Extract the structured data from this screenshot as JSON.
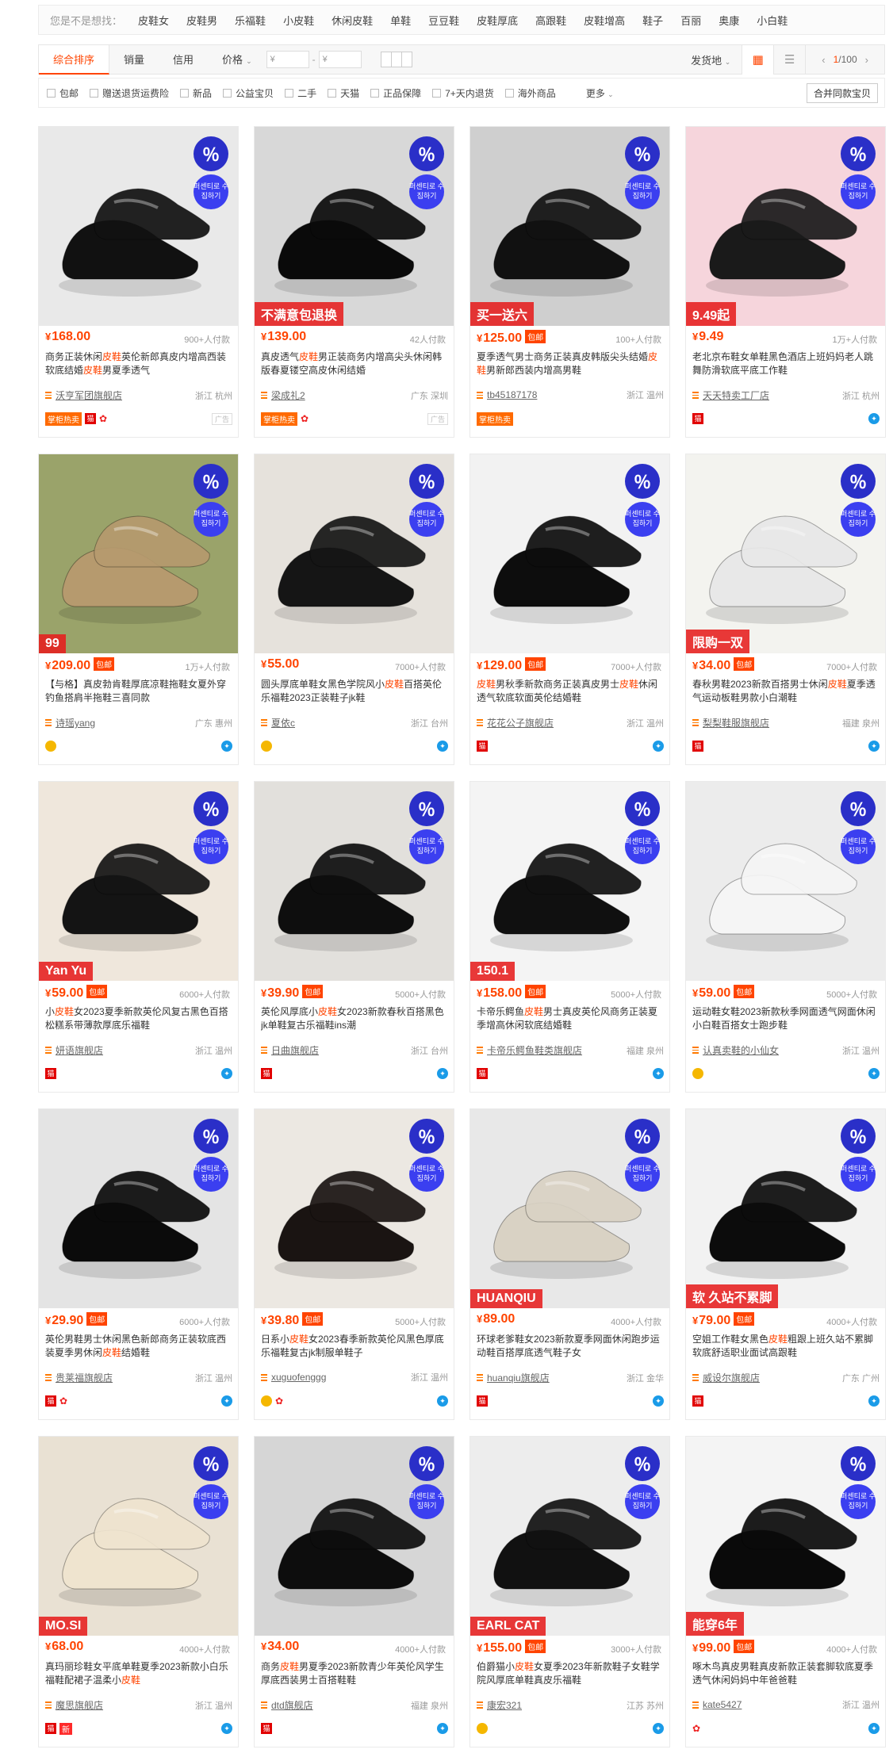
{
  "suggest": {
    "label": "您是不是想找：",
    "keywords": [
      "皮鞋女",
      "皮鞋男",
      "乐福鞋",
      "小皮鞋",
      "休闲皮鞋",
      "单鞋",
      "豆豆鞋",
      "皮鞋厚底",
      "高跟鞋",
      "皮鞋增高",
      "鞋子",
      "百丽",
      "奥康",
      "小白鞋"
    ]
  },
  "sortbar": {
    "tabs": [
      "综合排序",
      "销量",
      "信用",
      "价格"
    ],
    "price_min_placeholder": "¥",
    "price_max_placeholder": "¥",
    "price_sep": "-",
    "ship_from": "发货地",
    "page_current": "1",
    "page_total": "/100"
  },
  "filters": {
    "items": [
      "包邮",
      "赠送退货运费险",
      "新品",
      "公益宝贝",
      "二手",
      "天猫",
      "正品保障",
      "7+天内退货",
      "海外商品"
    ],
    "more": "更多",
    "merge": "合并同款宝贝"
  },
  "icons": {
    "search_badge": "percent-circle-icon",
    "shop": "shop-icon",
    "tmall": "tmall-icon",
    "prev": "chevron-left-icon",
    "next": "chevron-right-icon",
    "grid_view": "grid-icon",
    "list_view": "list-icon"
  },
  "colors": {
    "accent": "#ff4400",
    "badge": "#2a2fc8"
  },
  "products": [
    {
      "price": "168.00",
      "bao": "",
      "sales": "900+人付款",
      "title": "商务正装休闲皮鞋英伦新郎真皮内增高西装软底结婚皮鞋男夏季透气",
      "shop": "沃亨军团旗舰店",
      "loc": "浙江 杭州",
      "hot": "掌柜热卖",
      "ad": "广告",
      "tmall": true,
      "flower": true,
      "gold": false,
      "new": false,
      "blue": false,
      "badge_text": "％",
      "pill_text": "퍼센티로 수집하기",
      "imgtext": "",
      "bg": "#e9e9e9",
      "shoe": "#111"
    },
    {
      "price": "139.00",
      "bao": "",
      "sales": "42人付款",
      "title": "真皮透气皮鞋男正装商务内增高尖头休闲韩版春夏镂空高皮休闲结婚",
      "shop": "梁成礼2",
      "loc": "广东 深圳",
      "hot": "掌柜热卖",
      "ad": "广告",
      "tmall": false,
      "flower": true,
      "gold": false,
      "new": false,
      "blue": false,
      "badge_text": "％",
      "pill_text": "퍼센티로 수집하기",
      "imgtext": "不满意包退换",
      "bg": "#d8d8d8",
      "shoe": "#0a0a0a"
    },
    {
      "price": "125.00",
      "bao": "包邮",
      "sales": "100+人付款",
      "title": "夏季透气男士商务正装真皮韩版尖头结婚皮鞋男新郎西装内增高男鞋",
      "shop": "tb45187178",
      "loc": "浙江 温州",
      "hot": "掌柜热卖",
      "ad": "",
      "tmall": false,
      "flower": false,
      "gold": false,
      "new": false,
      "blue": false,
      "badge_text": "％",
      "pill_text": "퍼센티로 수집하기",
      "imgtext": "买一送六",
      "bg": "#cfcfcf",
      "shoe": "#111"
    },
    {
      "price": "9.49",
      "bao": "",
      "sales": "1万+人付款",
      "title": "老北京布鞋女单鞋黑色酒店上班妈妈老人跳舞防滑软底平底工作鞋",
      "shop": "天天特卖工厂店",
      "loc": "浙江 杭州",
      "hot": "",
      "ad": "",
      "tmall": true,
      "flower": false,
      "gold": false,
      "new": false,
      "blue": true,
      "badge_text": "％",
      "pill_text": "퍼센티로 수집하기",
      "imgtext": "9.49起",
      "bg": "#f6d5dc",
      "shoe": "#1a1a1a"
    },
    {
      "price": "209.00",
      "bao": "包邮",
      "sales": "1万+人付款",
      "title": "【与格】真皮勃肯鞋厚底凉鞋拖鞋女夏外穿钓鱼搭肩半拖鞋三喜同款",
      "shop": "诗瑶yang",
      "loc": "广东 惠州",
      "hot": "",
      "ad": "",
      "tmall": false,
      "flower": false,
      "gold": true,
      "new": false,
      "blue": true,
      "badge_text": "％",
      "pill_text": "퍼센티로 수집하기",
      "imgtext": "99",
      "bg": "#9aa36a",
      "shoe": "#b69a6e"
    },
    {
      "price": "55.00",
      "bao": "",
      "sales": "7000+人付款",
      "title": "圆头厚底单鞋女黑色学院风小皮鞋百搭英伦乐福鞋2023正装鞋子jk鞋",
      "shop": "夏依c",
      "loc": "浙江 台州",
      "hot": "",
      "ad": "",
      "tmall": false,
      "flower": false,
      "gold": true,
      "new": false,
      "blue": true,
      "badge_text": "％",
      "pill_text": "퍼센티로 수집하기",
      "imgtext": "",
      "bg": "#e6e2dc",
      "shoe": "#151515"
    },
    {
      "price": "129.00",
      "bao": "包邮",
      "sales": "7000+人付款",
      "title": "皮鞋男秋季新款商务正装真皮男士皮鞋休闲透气软底软面英伦结婚鞋",
      "shop": "花花公子旗舰店",
      "loc": "浙江 温州",
      "hot": "",
      "ad": "",
      "tmall": true,
      "flower": false,
      "gold": false,
      "new": false,
      "blue": true,
      "badge_text": "％",
      "pill_text": "퍼센티로 수집하기",
      "imgtext": "",
      "bg": "#f2f2f2",
      "shoe": "#0d0d0d"
    },
    {
      "price": "34.00",
      "bao": "包邮",
      "sales": "7000+人付款",
      "title": "春秋男鞋2023新款百搭男士休闲皮鞋夏季透气运动板鞋男款小白潮鞋",
      "shop": "梨梨鞋服旗舰店",
      "loc": "福建 泉州",
      "hot": "",
      "ad": "",
      "tmall": true,
      "flower": false,
      "gold": false,
      "new": false,
      "blue": true,
      "badge_text": "％",
      "pill_text": "퍼센티로 수집하기",
      "imgtext": "限购一双",
      "bg": "#f3f3ef",
      "shoe": "#e8e8e8"
    },
    {
      "price": "59.00",
      "bao": "包邮",
      "sales": "6000+人付款",
      "title": "小皮鞋女2023夏季新款英伦风复古黑色百搭松糕系带薄款厚底乐福鞋",
      "shop": "妍语旗舰店",
      "loc": "浙江 温州",
      "hot": "",
      "ad": "",
      "tmall": true,
      "flower": false,
      "gold": false,
      "new": false,
      "blue": true,
      "badge_text": "％",
      "pill_text": "퍼센티로 수집하기",
      "imgtext": "Yan Yu",
      "bg": "#efe7dc",
      "shoe": "#141414"
    },
    {
      "price": "39.90",
      "bao": "包邮",
      "sales": "5000+人付款",
      "title": "英伦风厚底小皮鞋女2023新款春秋百搭黑色jk单鞋复古乐福鞋ins潮",
      "shop": "日曲旗舰店",
      "loc": "浙江 台州",
      "hot": "",
      "ad": "",
      "tmall": true,
      "flower": false,
      "gold": false,
      "new": false,
      "blue": true,
      "badge_text": "％",
      "pill_text": "퍼센티로 수집하기",
      "imgtext": "",
      "bg": "#e2e0dc",
      "shoe": "#0e0e0e"
    },
    {
      "price": "158.00",
      "bao": "包邮",
      "sales": "5000+人付款",
      "title": "卡帝乐鳄鱼皮鞋男士真皮英伦风商务正装夏季增高休闲软底结婚鞋",
      "shop": "卡帝乐鳄鱼鞋类旗舰店",
      "loc": "福建 泉州",
      "hot": "",
      "ad": "",
      "tmall": true,
      "flower": false,
      "gold": false,
      "new": false,
      "blue": true,
      "badge_text": "％",
      "pill_text": "퍼센티로 수집하기",
      "imgtext": "150.1",
      "bg": "#f4f4f4",
      "shoe": "#101010"
    },
    {
      "price": "59.00",
      "bao": "包邮",
      "sales": "5000+人付款",
      "title": "运动鞋女鞋2023新款秋季网面透气网面休闲小白鞋百搭女士跑步鞋",
      "shop": "认真卖鞋的小仙女",
      "loc": "浙江 温州",
      "hot": "",
      "ad": "",
      "tmall": false,
      "flower": false,
      "gold": true,
      "new": false,
      "blue": true,
      "badge_text": "％",
      "pill_text": "퍼센티로 수집하기",
      "imgtext": "",
      "bg": "#ececec",
      "shoe": "#f5f5f5"
    },
    {
      "price": "29.90",
      "bao": "包邮",
      "sales": "6000+人付款",
      "title": "英伦男鞋男士休闲黑色新郎商务正装软底西装夏季男休闲皮鞋结婚鞋",
      "shop": "贵莱福旗舰店",
      "loc": "浙江 温州",
      "hot": "",
      "ad": "",
      "tmall": true,
      "flower": true,
      "gold": false,
      "new": false,
      "blue": true,
      "badge_text": "％",
      "pill_text": "퍼센티로 수집하기",
      "imgtext": "",
      "bg": "#e4e4e4",
      "shoe": "#0b0b0b"
    },
    {
      "price": "39.80",
      "bao": "包邮",
      "sales": "5000+人付款",
      "title": "日系小皮鞋女2023春季新款英伦风黑色厚底乐福鞋复古jk制服单鞋子",
      "shop": "xuguofenggg",
      "loc": "浙江 温州",
      "hot": "",
      "ad": "",
      "tmall": false,
      "flower": true,
      "gold": true,
      "new": false,
      "blue": true,
      "badge_text": "％",
      "pill_text": "퍼센티로 수집하기",
      "imgtext": "",
      "bg": "#ece8e2",
      "shoe": "#1a1412"
    },
    {
      "price": "89.00",
      "bao": "",
      "sales": "4000+人付款",
      "title": "环球老爹鞋女2023新款夏季网面休闲跑步运动鞋百搭厚底透气鞋子女",
      "shop": "huanqiu旗舰店",
      "loc": "浙江 金华",
      "hot": "",
      "ad": "",
      "tmall": true,
      "flower": false,
      "gold": false,
      "new": false,
      "blue": true,
      "badge_text": "％",
      "pill_text": "퍼센티로 수집하기",
      "imgtext": "HUANQIU",
      "bg": "#e8e8e8",
      "shoe": "#d9d2c4"
    },
    {
      "price": "79.00",
      "bao": "包邮",
      "sales": "4000+人付款",
      "title": "空姐工作鞋女黑色皮鞋粗跟上班久站不累脚软底舒适职业面试高跟鞋",
      "shop": "威设尔旗舰店",
      "loc": "广东 广州",
      "hot": "",
      "ad": "",
      "tmall": true,
      "flower": false,
      "gold": false,
      "new": false,
      "blue": true,
      "badge_text": "％",
      "pill_text": "퍼센티로 수집하기",
      "imgtext": "软 久站不累脚",
      "bg": "#f2f2f2",
      "shoe": "#0c0c0c"
    },
    {
      "price": "68.00",
      "bao": "",
      "sales": "4000+人付款",
      "title": "真玛丽珍鞋女平底单鞋夏季2023新款小白乐福鞋配裙子温柔小皮鞋",
      "shop": "魔思旗舰店",
      "loc": "浙江 温州",
      "hot": "",
      "ad": "",
      "tmall": true,
      "flower": false,
      "gold": false,
      "new": true,
      "blue": true,
      "badge_text": "％",
      "pill_text": "퍼센티로 수집하기",
      "imgtext": "MO.SI",
      "bg": "#e9e1d3",
      "shoe": "#efe4cf"
    },
    {
      "price": "34.00",
      "bao": "",
      "sales": "4000+人付款",
      "title": "商务皮鞋男夏季2023新款青少年英伦风学生厚底西装男士百搭鞋鞋",
      "shop": "dtd旗舰店",
      "loc": "福建 泉州",
      "hot": "",
      "ad": "",
      "tmall": true,
      "flower": false,
      "gold": false,
      "new": false,
      "blue": true,
      "badge_text": "％",
      "pill_text": "퍼센티로 수집하기",
      "imgtext": "",
      "bg": "#d6d6d6",
      "shoe": "#0d0d0d"
    },
    {
      "price": "155.00",
      "bao": "包邮",
      "sales": "3000+人付款",
      "title": "伯爵猫小皮鞋女夏季2023年新款鞋子女鞋学院风厚底单鞋真皮乐福鞋",
      "shop": "康宏321",
      "loc": "江苏 苏州",
      "hot": "",
      "ad": "",
      "tmall": false,
      "flower": false,
      "gold": true,
      "new": false,
      "blue": true,
      "badge_text": "％",
      "pill_text": "퍼센티로 수집하기",
      "imgtext": "EARL CAT",
      "bg": "#ededed",
      "shoe": "#111"
    },
    {
      "price": "99.00",
      "bao": "包邮",
      "sales": "4000+人付款",
      "title": "啄木鸟真皮男鞋真皮新款正装套脚软底夏季透气休闲妈妈中年爸爸鞋",
      "shop": "kate5427",
      "loc": "浙江 温州",
      "hot": "",
      "ad": "",
      "tmall": false,
      "flower": true,
      "gold": false,
      "new": false,
      "blue": true,
      "badge_text": "％",
      "pill_text": "퍼센티로 수집하기",
      "imgtext": "能穿6年",
      "bg": "#f4f4f4",
      "shoe": "#0a0a0a"
    }
  ]
}
